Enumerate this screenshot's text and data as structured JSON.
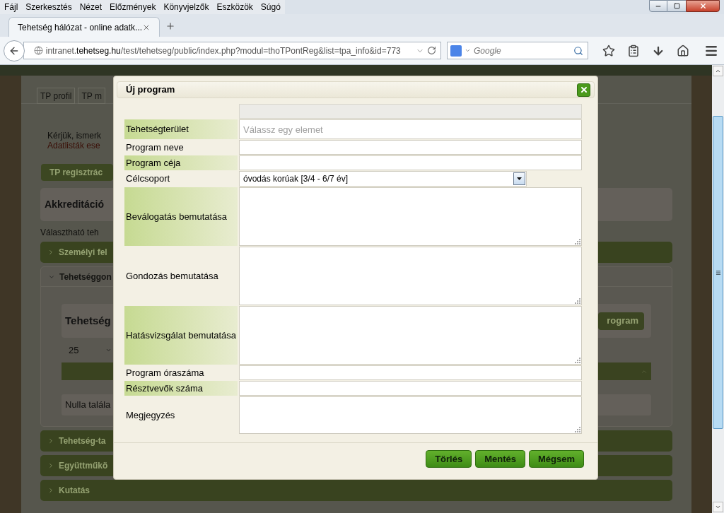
{
  "browser": {
    "menu": [
      "Fájl",
      "Szerkesztés",
      "Nézet",
      "Előzmények",
      "Könyvjelzők",
      "Eszközök",
      "Súgó"
    ],
    "tab": {
      "title": "Tehetség hálózat - online adatk..."
    },
    "url": "intranet.**tehetseg.hu**/test/tehetseg/public/index.php?modul=thoTPontReg&list=tpa_info&id=773",
    "search": {
      "placeholder": "Google"
    }
  },
  "page": {
    "tabs": [
      "TP profil",
      "TP m"
    ],
    "notice": "Kérjük, ismerk",
    "warning": "Adatlisták ese",
    "register_button": "TP regisztrác",
    "heading": "Akkreditáció",
    "intro": "Választható teh",
    "sections": [
      {
        "title": "Személyi fel",
        "expanded": false
      },
      {
        "title": "Tehetséggon",
        "expanded": true,
        "panel_title": "Tehetség",
        "action_button": "rogram",
        "page_size": "25",
        "empty_text": "Nulla talála"
      },
      {
        "title": "Tehetség-ta",
        "expanded": false
      },
      {
        "title": "Együttműkö",
        "expanded": false
      },
      {
        "title": "Kutatás",
        "expanded": false
      }
    ]
  },
  "dialog": {
    "title": "Új program",
    "fields": [
      {
        "kind": "readonly"
      },
      {
        "kind": "combo",
        "label": "Tehetségterület",
        "placeholder": "Válassz egy elemet"
      },
      {
        "kind": "text",
        "label": "Program neve"
      },
      {
        "kind": "text",
        "label": "Program céja"
      },
      {
        "kind": "select",
        "label": "Célcsoport",
        "value": "óvodás korúak [3/4 - 6/7 év]"
      },
      {
        "kind": "textarea",
        "label": "Beválogatás bemutatása"
      },
      {
        "kind": "textarea",
        "label": "Gondozás bemutatása"
      },
      {
        "kind": "textarea",
        "label": "Hatásvizsgálat bemutatása"
      },
      {
        "kind": "text",
        "label": "Program óraszáma"
      },
      {
        "kind": "text",
        "label": "Résztvevők száma"
      },
      {
        "kind": "memo",
        "label": "Megjegyzés"
      }
    ],
    "buttons": [
      "Törlés",
      "Mentés",
      "Mégsem"
    ]
  }
}
